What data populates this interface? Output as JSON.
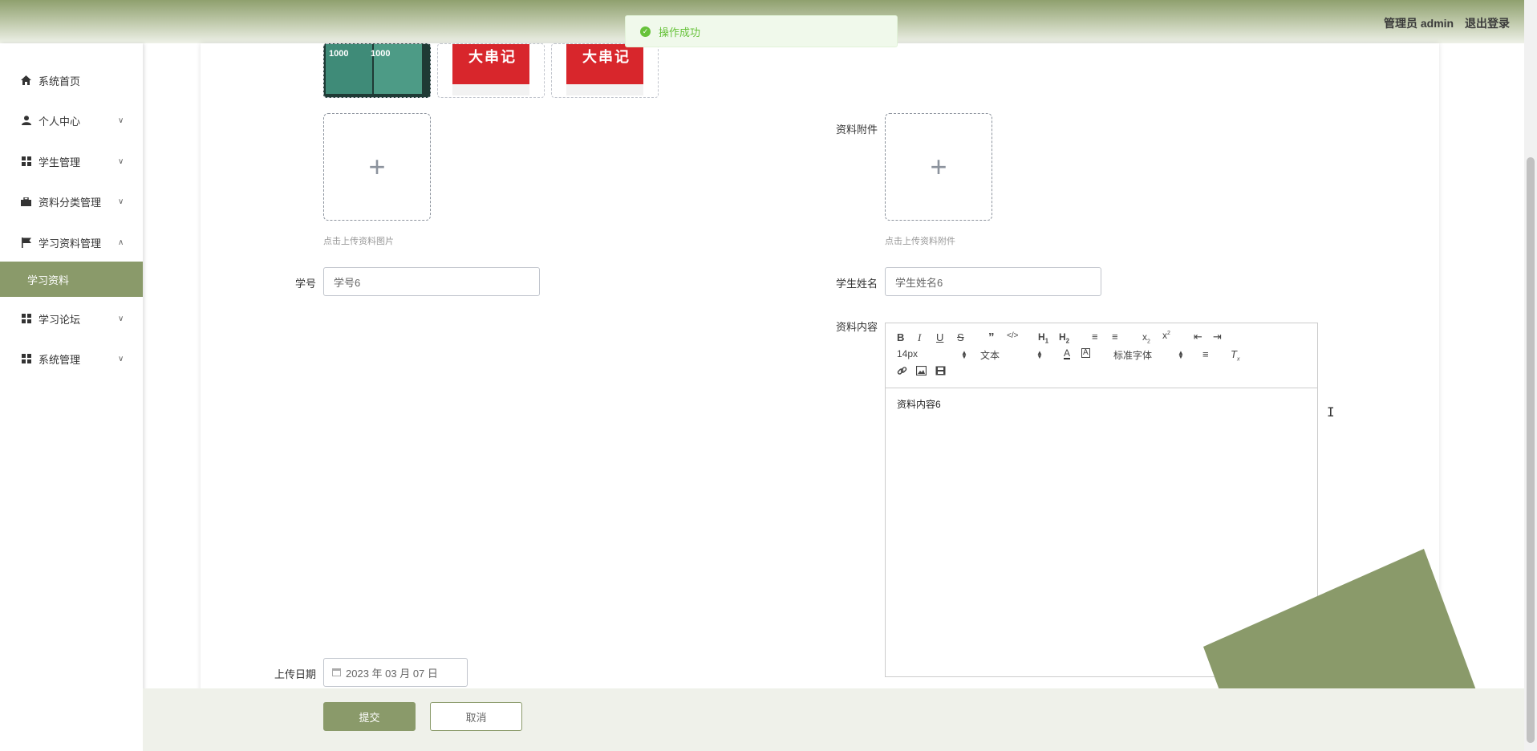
{
  "header": {
    "user_label": "管理员 admin",
    "logout_label": "退出登录"
  },
  "toast": {
    "message": "操作成功",
    "icon": "success-check-icon"
  },
  "sidebar": {
    "items": [
      {
        "label": "系统首页",
        "icon": "home-icon",
        "has_children": false
      },
      {
        "label": "个人中心",
        "icon": "user-icon",
        "has_children": true
      },
      {
        "label": "学生管理",
        "icon": "grid-icon",
        "has_children": true
      },
      {
        "label": "资料分类管理",
        "icon": "briefcase-icon",
        "has_children": true
      },
      {
        "label": "学习资料管理",
        "icon": "flag-icon",
        "has_children": true,
        "expanded": true
      },
      {
        "label": "学习论坛",
        "icon": "grid-icon",
        "has_children": true
      },
      {
        "label": "系统管理",
        "icon": "grid-icon",
        "has_children": true
      }
    ],
    "active_subitem": "学习资料"
  },
  "form": {
    "thumbnails": [
      {
        "overlay_text": "1000",
        "overlay_text_2": "1000"
      },
      {
        "overlay_text": "大串记"
      },
      {
        "overlay_text": "大串记"
      }
    ],
    "image_upload_hint": "点击上传资料图片",
    "attachment_label": "资料附件",
    "attachment_hint": "点击上传资料附件",
    "student_id_label": "学号",
    "student_id_value": "学号6",
    "student_name_label": "学生姓名",
    "student_name_value": "学生姓名6",
    "content_label": "资料内容",
    "editor": {
      "font_size": "14px",
      "header_select": "文本",
      "font_family": "标准字体",
      "content": "资料内容6"
    },
    "upload_date_label": "上传日期",
    "upload_date_value": "2023 年 03 月 07 日"
  },
  "actions": {
    "submit_label": "提交",
    "cancel_label": "取消"
  },
  "colors": {
    "accent": "#8a9a6a",
    "success": "#67c23a"
  }
}
